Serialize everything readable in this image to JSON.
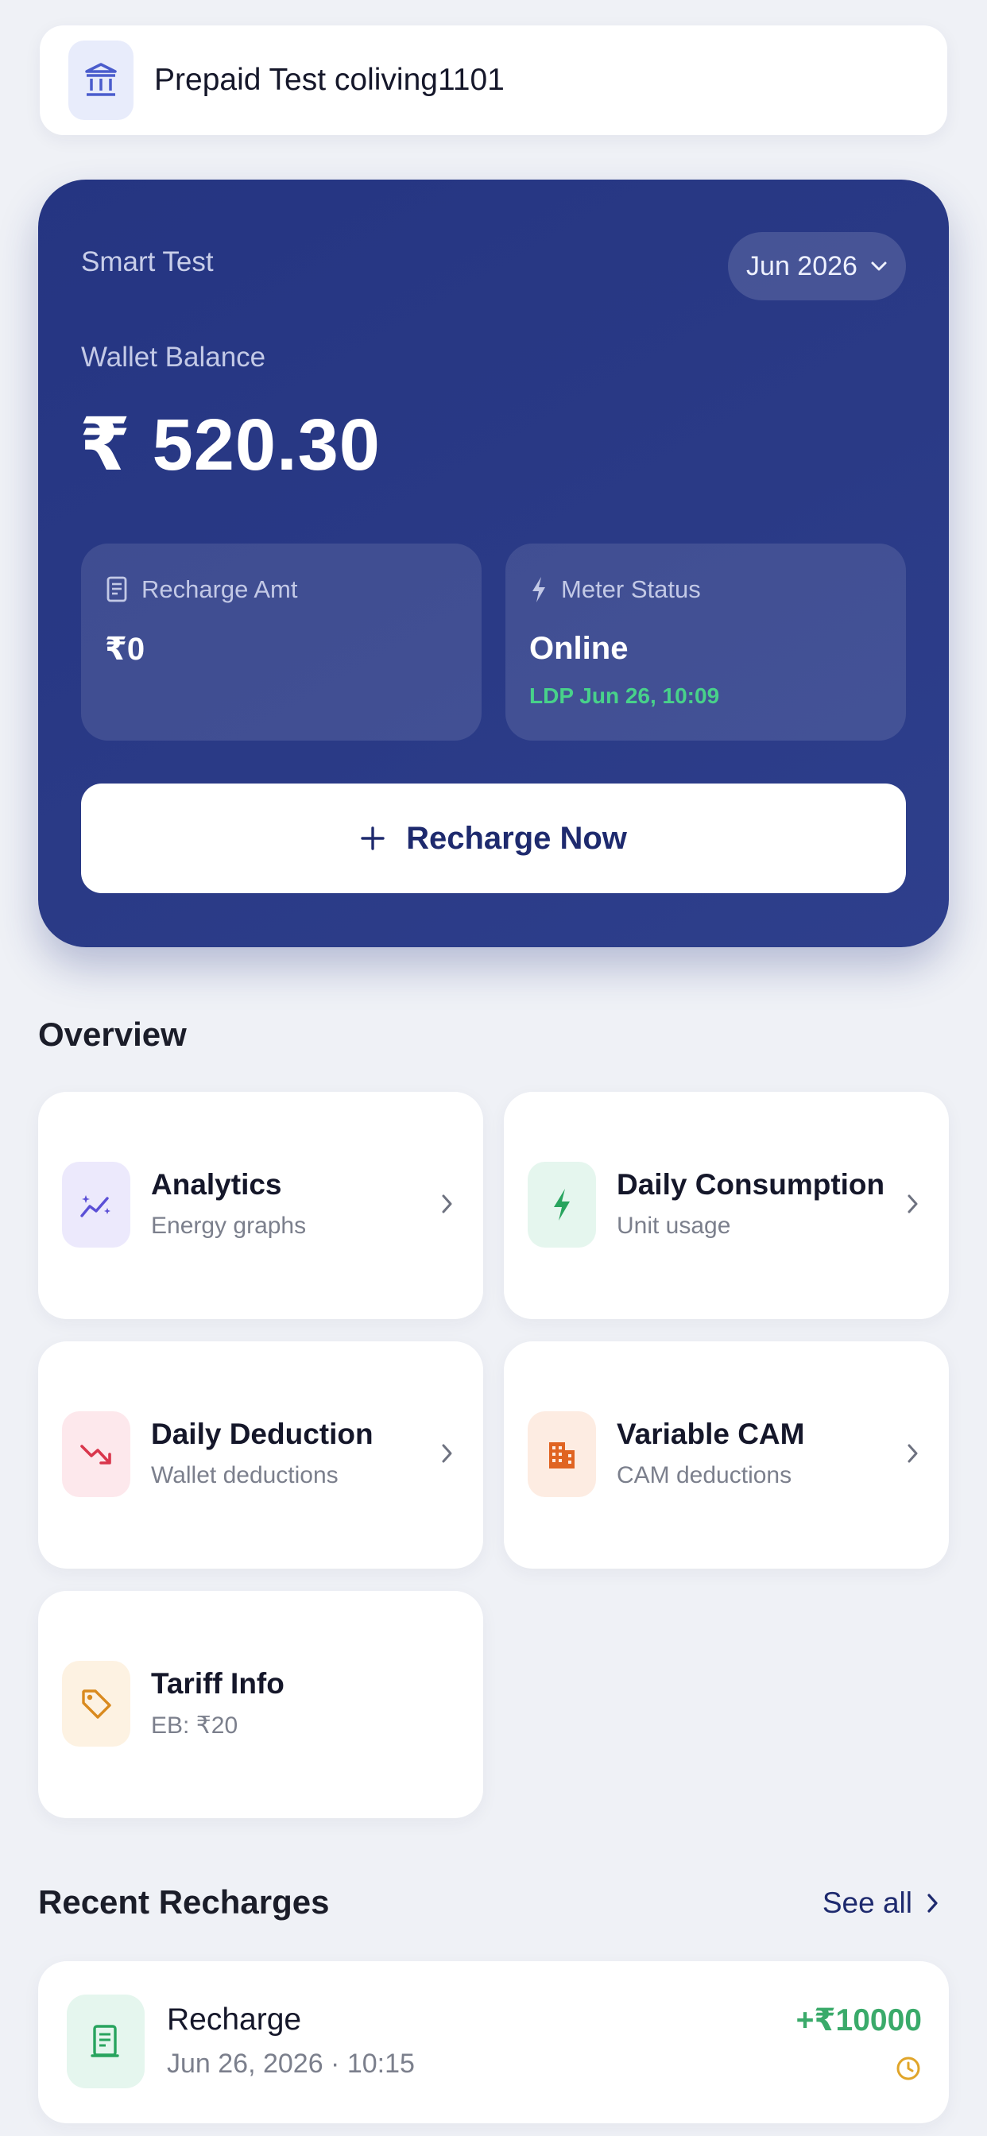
{
  "property": {
    "name": "Prepaid Test coliving1101",
    "icon": "bank-icon"
  },
  "wallet": {
    "meter_name": "Smart Test",
    "month": "Jun 2026",
    "balance_label": "Wallet Balance",
    "balance": "₹ 520.30",
    "recharge_amt_label": "Recharge Amt",
    "recharge_amt_value": "₹0",
    "meter_status_label": "Meter Status",
    "meter_status_value": "Online",
    "meter_status_sub": "LDP Jun 26, 10:09",
    "recharge_button": "Recharge Now"
  },
  "overview": {
    "title": "Overview",
    "tiles": [
      {
        "title": "Analytics",
        "subtitle": "Energy graphs",
        "icon": "sparkle-chart-icon",
        "color": "#5b4fd6",
        "bg": "#ece9fc"
      },
      {
        "title": "Daily Consumption",
        "subtitle": "Unit usage",
        "icon": "bolt-icon",
        "color": "#28a45e",
        "bg": "#e5f6ee"
      },
      {
        "title": "Daily Deduction",
        "subtitle": "Wallet deductions",
        "icon": "trend-down-icon",
        "color": "#d9364c",
        "bg": "#fde8ec"
      },
      {
        "title": "Variable CAM",
        "subtitle": "CAM deductions",
        "icon": "building-icon",
        "color": "#e06422",
        "bg": "#fdece2"
      },
      {
        "title": "Tariff Info",
        "subtitle": "EB: ₹20",
        "icon": "tag-icon",
        "color": "#d98a1e",
        "bg": "#fdf2e2"
      }
    ]
  },
  "recent": {
    "title": "Recent Recharges",
    "see_all": "See all",
    "items": [
      {
        "title": "Recharge",
        "date": "Jun 26, 2026 · 10:15",
        "amount": "+₹10000",
        "status_icon": "clock-icon"
      }
    ]
  },
  "colors": {
    "primary": "#263583",
    "success": "#3aaa6a",
    "online": "#48d18a",
    "pending": "#e0a52a"
  }
}
